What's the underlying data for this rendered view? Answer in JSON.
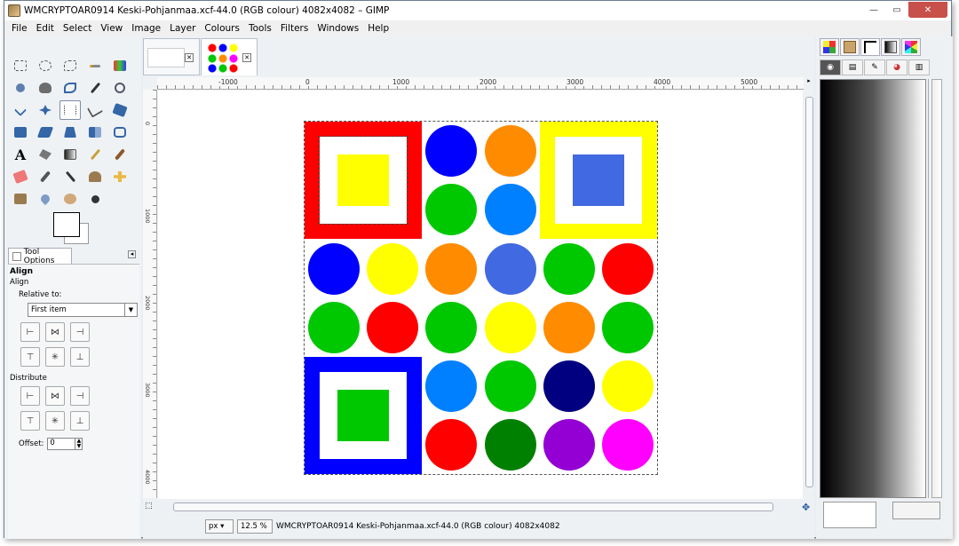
{
  "window": {
    "title": "WMCRYPTOAR0914 Keski-Pohjanmaa.xcf-44.0 (RGB colour) 4082x4082 – GIMP"
  },
  "controls": {
    "minimize": "—",
    "maximize": "▭",
    "close": "✕"
  },
  "menu": [
    "File",
    "Edit",
    "Select",
    "View",
    "Image",
    "Layer",
    "Colours",
    "Tools",
    "Filters",
    "Windows",
    "Help"
  ],
  "tool_options": {
    "tab_label": "Tool Options",
    "heading": "Align",
    "sub": "Align",
    "relative_to_label": "Relative to:",
    "relative_to_value": "First item",
    "distribute_label": "Distribute",
    "offset_label": "Offset:",
    "offset_value": "0"
  },
  "ruler": {
    "h_labels": [
      "-1000",
      "0",
      "1000",
      "2000",
      "3000",
      "4000",
      "5000"
    ],
    "v_labels": [
      "0",
      "1000",
      "2000",
      "3000",
      "4000"
    ]
  },
  "status": {
    "unit": "px",
    "zoom": "12.5 %",
    "text": "WMCRYPTOAR0914 Keski-Pohjanmaa.xcf-44.0 (RGB colour) 4082x4082"
  },
  "colors": {
    "red": "#ff0000",
    "yellow": "#ffff00",
    "blue": "#0000ff",
    "green": "#00c800",
    "orange": "#ff8c00",
    "azure": "#0080ff",
    "royal": "#4169e1",
    "navy": "#000080",
    "darkgreen": "#008000",
    "purple": "#9400d3",
    "magenta": "#ff00ff"
  }
}
